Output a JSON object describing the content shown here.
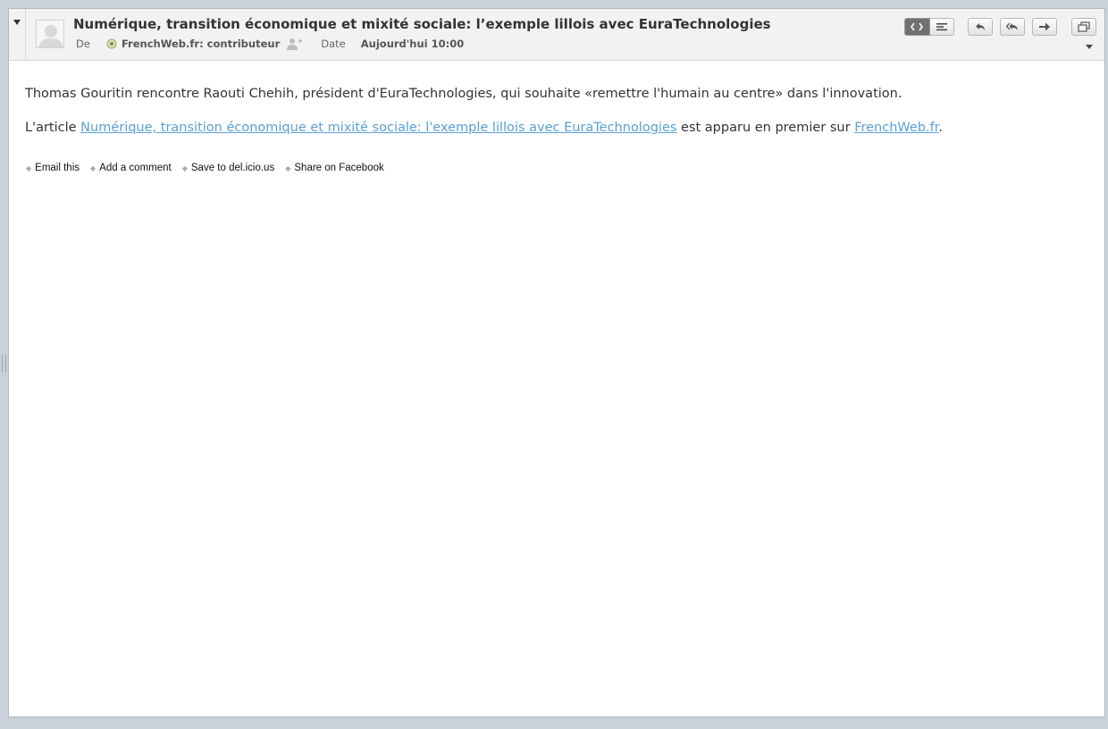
{
  "message": {
    "subject": "Numérique, transition économique et mixité sociale: l’exemple lillois avec EuraTechnologies",
    "from_label": "De",
    "sender": "FrenchWeb.fr: contributeur",
    "date_label": "Date",
    "date_value": "Aujourd'hui 10:00"
  },
  "toolbar": {
    "buttons": [
      "view-html-toggle",
      "view-plain-toggle",
      "reply",
      "reply-all",
      "forward",
      "open-window"
    ]
  },
  "body": {
    "paragraph1": "Thomas Gouritin rencontre Raouti Chehih, président d'EuraTechnologies, qui souhaite «remettre l'humain au centre» dans l'innovation.",
    "p2_prefix": "L'article ",
    "p2_link": "Numérique, transition économique et mixité sociale: l'exemple lillois avec EuraTechnologies",
    "p2_middle": " est apparu en premier sur ",
    "p2_site_link": "FrenchWeb.fr",
    "p2_suffix": "."
  },
  "share_links": [
    {
      "label": "Email this"
    },
    {
      "label": "Add a comment"
    },
    {
      "label": "Save to del.icio.us"
    },
    {
      "label": "Share on Facebook"
    }
  ],
  "colors": {
    "link": "#5aa0d6",
    "background": "#c9d2da",
    "header": "#f2f2f2"
  }
}
